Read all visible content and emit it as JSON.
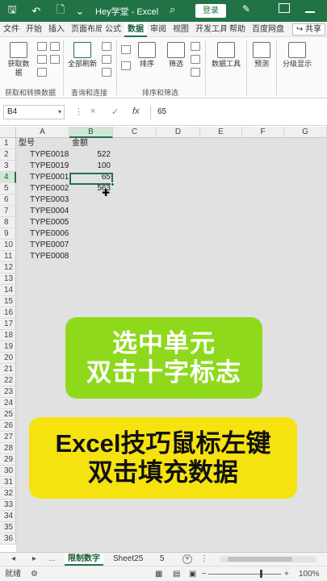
{
  "titlebar": {
    "save_icon": "save-icon",
    "undo_icon": "undo-icon",
    "file_icon": "new-file-icon",
    "title": "Hey学堂 - Excel",
    "login_label": "登录"
  },
  "tabs": [
    "文件",
    "开始",
    "插入",
    "页面布局",
    "公式",
    "数据",
    "审阅",
    "视图",
    "开发工具",
    "帮助",
    "百度网盘"
  ],
  "active_tab": "数据",
  "share_label": "共享",
  "ribbon": {
    "get_data_label": "获取数\n据",
    "get_transform_group": "获取和转换数据",
    "refresh_all_label": "全部刷新",
    "query_group": "查询和连接",
    "sort_label": "排序",
    "filter_label": "筛选",
    "sort_filter_group": "排序和筛选",
    "data_tools_label": "数据工具",
    "forecast_label": "预测",
    "outline_label": "分级显示"
  },
  "formula_bar": {
    "name_box": "B4",
    "cancel_symbol": "×",
    "confirm_symbol": "✓",
    "fx_symbol": "fx",
    "value": "65"
  },
  "columns": [
    "A",
    "B",
    "C",
    "D",
    "E",
    "F",
    "G"
  ],
  "rows": [
    "1",
    "2",
    "3",
    "4",
    "5",
    "6",
    "7",
    "8",
    "9",
    "10",
    "11",
    "12",
    "13",
    "14",
    "15",
    "16",
    "17",
    "18",
    "19",
    "20",
    "21",
    "22",
    "23",
    "24",
    "25",
    "26",
    "27",
    "28",
    "29",
    "30",
    "31",
    "32",
    "33",
    "34",
    "35",
    "36"
  ],
  "selected_cell": "B4",
  "cells": {
    "A1": "型号",
    "B1": "金额",
    "A2": "TYPE0018",
    "B2": "522",
    "A3": "TYPE0019",
    "B3": "100",
    "A4": "TYPE0001",
    "B4": "65",
    "A5": "TYPE0002",
    "B5": "563",
    "A6": "TYPE0003",
    "A7": "TYPE0004",
    "A8": "TYPE0005",
    "A9": "TYPE0006",
    "A10": "TYPE0007",
    "A11": "TYPE0008"
  },
  "overlay1": {
    "line1": "选中单元",
    "line2": "双击十字标志",
    "color": "#8ed91c"
  },
  "overlay2": {
    "line1": "Excel技巧鼠标左键",
    "line2": "双击填充数据",
    "color": "#f5e20f"
  },
  "sheet_tabs": {
    "ellipsis": "...",
    "active": "限制数字",
    "next": "Sheet25",
    "more": "5",
    "add": "+"
  },
  "status": {
    "ready": "就绪",
    "zoom": "100%"
  },
  "accent_color": "#217346"
}
